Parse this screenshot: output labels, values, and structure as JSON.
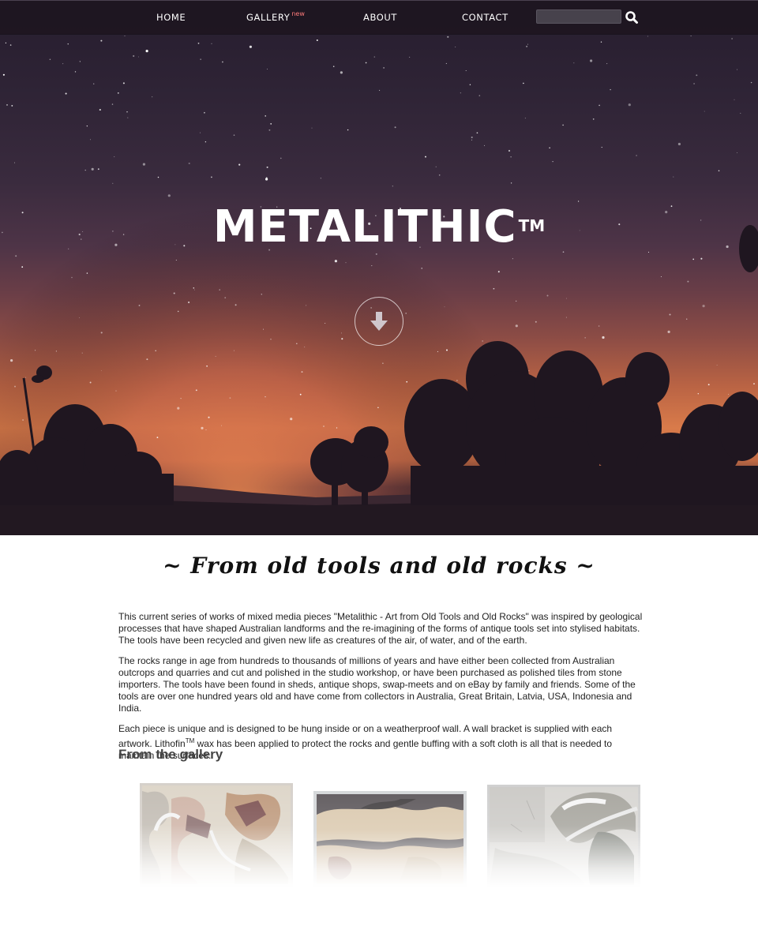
{
  "nav": {
    "items": [
      {
        "label": "HOME",
        "badge": ""
      },
      {
        "label": "GALLERY",
        "badge": "new"
      },
      {
        "label": "ABOUT",
        "badge": ""
      },
      {
        "label": "CONTACT",
        "badge": ""
      }
    ],
    "search": {
      "placeholder": "",
      "value": "",
      "icon": "search-icon"
    }
  },
  "hero": {
    "title": "METALITHIC",
    "trademark": "TM",
    "scroll_icon": "arrow-down-circle-icon"
  },
  "content": {
    "tagline": "~ From old tools and old rocks ~",
    "paragraphs": [
      "This current series of works of mixed media pieces \"Metalithic - Art from Old Tools and Old Rocks\" was inspired by geological processes that have shaped Australian landforms and the re-imagining of the forms of antique tools set into stylised habitats. The tools have been recycled and given new life as creatures of the air, of water, and of the earth.",
      "The rocks range in age from hundreds to thousands of millions of years and have either been collected from Australian outcrops and quarries and cut and polished in the studio workshop, or have been purchased as polished tiles from stone importers. The tools have been found in sheds, antique shops, swap-meets and on eBay by family and friends. Some of the tools are over one hundred years old and have come from collectors in Australia, Great Britain, Latvia, USA, Indonesia and India."
    ],
    "paragraph3": {
      "text_before": "Each piece is unique and is designed to be hung inside or on a weatherproof wall. A wall bracket is supplied with each artwork. Lithofin",
      "sup": "TM",
      "text_after": " wax has been applied to protect the rocks and gentle buffing with a soft cloth is all that is needed to maintain the surfaces."
    },
    "gallery_heading": "From the gallery"
  },
  "colors": {
    "nav_bg": "#1c141e",
    "badge": "#ff7b7b",
    "sky_top": "#261d2e",
    "horizon_glow": "#d97b4a",
    "text": "#222222",
    "heading": "#444444"
  }
}
